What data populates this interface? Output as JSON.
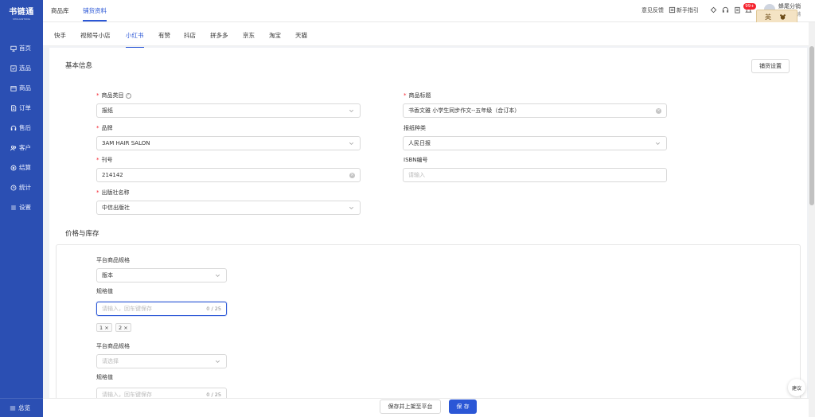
{
  "app": {
    "logo_main": "书链通",
    "logo_sub": "SHULIANTONG"
  },
  "sidebar": {
    "items": [
      {
        "label": "首页",
        "icon": "monitor-icon"
      },
      {
        "label": "选品",
        "icon": "select-icon"
      },
      {
        "label": "商品",
        "icon": "box-icon"
      },
      {
        "label": "订单",
        "icon": "order-icon"
      },
      {
        "label": "售后",
        "icon": "headset-icon"
      },
      {
        "label": "客户",
        "icon": "users-icon"
      },
      {
        "label": "结算",
        "icon": "settle-icon"
      },
      {
        "label": "统计",
        "icon": "clock-icon"
      },
      {
        "label": "设置",
        "icon": "settings-icon"
      }
    ],
    "bottom_label": "总览"
  },
  "header": {
    "tabs": [
      "商品库",
      "铺货资料"
    ],
    "active_tab": "铺货资料",
    "feedback": "意见反馈",
    "guide": "新手指引",
    "badge": "99+",
    "user_name": "蜂尾分销",
    "user_sub": "店铺"
  },
  "ime": {
    "lang": "英"
  },
  "subtabs": [
    "快手",
    "视频号小店",
    "小红书",
    "有赞",
    "抖店",
    "拼多多",
    "京东",
    "淘宝",
    "天猫"
  ],
  "active_subtab": "小红书",
  "basic": {
    "title": "基本信息",
    "settings_button": "铺货设置",
    "category_label": "商品类目",
    "category_value": "报纸",
    "title_label": "商品标题",
    "title_value": "书香文雅 小学生同步作文--五年级（合订本）",
    "brand_label": "品牌",
    "brand_value": "3AM HAIR SALON",
    "paper_type_label": "报纸种类",
    "paper_type_value": "人民日报",
    "issue_label": "刊号",
    "issue_value": "214142",
    "isbn_label": "ISBN编号",
    "isbn_placeholder": "请输入",
    "publisher_label": "出版社名称",
    "publisher_value": "中信出版社"
  },
  "price": {
    "title": "价格与库存",
    "spec1_label": "平台商品规格",
    "spec1_value": "版本",
    "spec_value_label": "规格值",
    "spec_value_placeholder": "请输入，回车键保存",
    "spec_value_count": "0 / 25",
    "tags": [
      "1 ×",
      "2 ×"
    ],
    "spec2_label": "平台商品规格",
    "spec2_placeholder": "请选择",
    "spec_value2_label": "规格值",
    "spec_value2_placeholder": "请输入，回车键保存",
    "spec_value2_count": "0 / 25"
  },
  "footer": {
    "save_publish": "保存并上架至平台",
    "save": "保 存"
  },
  "float": {
    "label": "建议"
  },
  "colors": {
    "sidebar": "#2b4fb3",
    "accent": "#2b57d6",
    "required": "#f5222d"
  }
}
